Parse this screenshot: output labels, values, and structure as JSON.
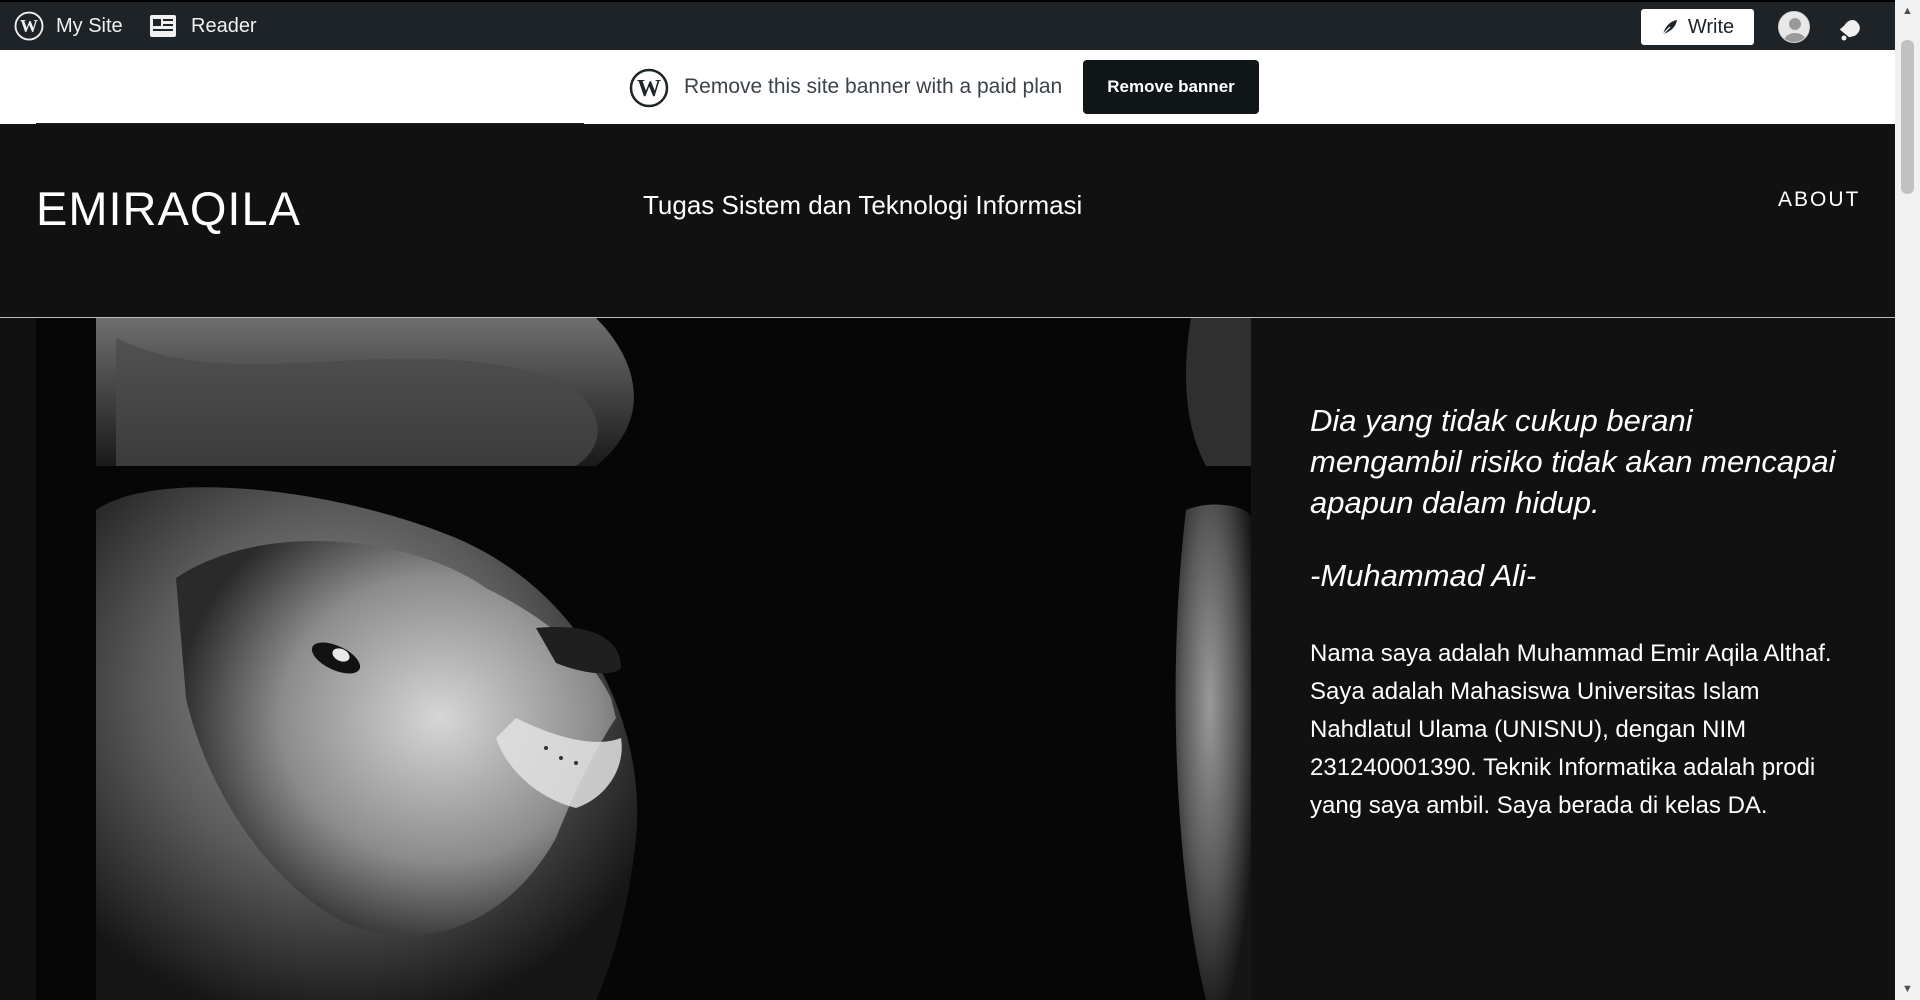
{
  "admin_bar": {
    "my_site_label": "My Site",
    "reader_label": "Reader",
    "write_label": "Write"
  },
  "banner": {
    "text": "Remove this site banner with a paid plan",
    "button_label": "Remove banner"
  },
  "site": {
    "title": "EMIRAQILA",
    "tagline": "Tugas Sistem dan Teknologi Informasi",
    "nav": [
      "ABOUT"
    ]
  },
  "content": {
    "quote": "Dia yang tidak cukup berani mengambil risiko tidak akan mencapai apapun dalam hidup.",
    "quote_author": "-Muhammad Ali-",
    "bio": "Nama saya adalah Muhammad Emir Aqila Althaf. Saya adalah Mahasiswa Universitas Islam Nahdlatul Ulama (UNISNU), dengan NIM 231240001390. Teknik Informatika adalah prodi yang saya ambil. Saya berada di kelas DA."
  },
  "icons": {
    "wordpress": "wordpress-logo-icon",
    "reader": "reader-icon",
    "write": "pen-icon",
    "avatar": "user-avatar-icon",
    "notifications": "bell-icon"
  },
  "colors": {
    "admin_bar_bg": "#1d2327",
    "site_bg": "#111111",
    "banner_button_bg": "#101517"
  }
}
